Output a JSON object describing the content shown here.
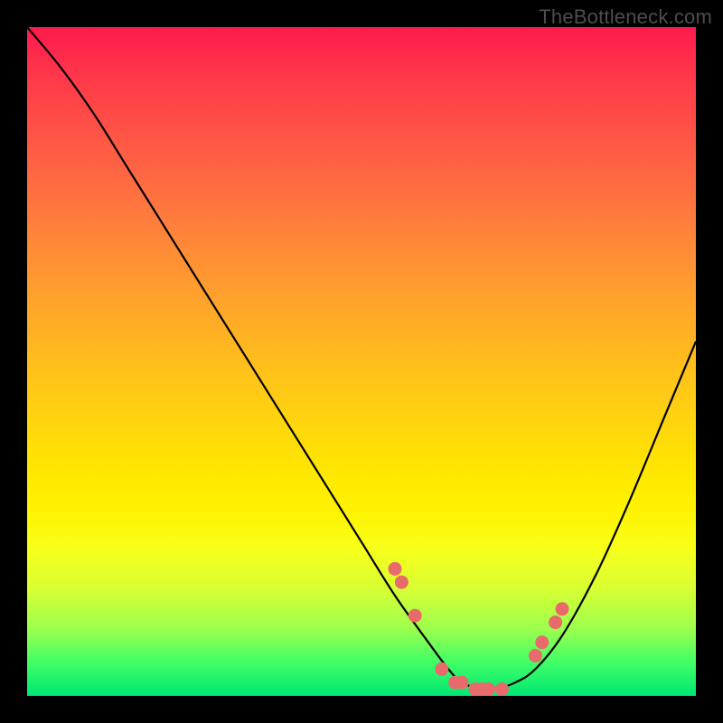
{
  "watermark": "TheBottleneck.com",
  "chart_data": {
    "type": "line",
    "title": "",
    "xlabel": "",
    "ylabel": "",
    "xlim": [
      0,
      100
    ],
    "ylim": [
      0,
      100
    ],
    "grid": false,
    "series": [
      {
        "name": "bottleneck-curve",
        "x": [
          0,
          5,
          10,
          15,
          20,
          25,
          30,
          35,
          40,
          45,
          50,
          55,
          60,
          63,
          65,
          68,
          70,
          73,
          76,
          80,
          85,
          90,
          95,
          100
        ],
        "values": [
          100,
          94,
          87,
          79,
          71,
          63,
          55,
          47,
          39,
          31,
          23,
          15,
          8,
          4,
          2,
          1,
          1,
          2,
          4,
          9,
          18,
          29,
          41,
          53
        ]
      }
    ],
    "markers": {
      "name": "highlighted-points",
      "color": "#e86a6a",
      "x": [
        55,
        56,
        58,
        62,
        64,
        65,
        67,
        68,
        69,
        71,
        76,
        77,
        79,
        80
      ],
      "values": [
        19,
        17,
        12,
        4,
        2,
        2,
        1,
        1,
        1,
        1,
        6,
        8,
        11,
        13
      ]
    },
    "gradient_stops": [
      {
        "pos": 0,
        "color": "#ff1a4d"
      },
      {
        "pos": 50,
        "color": "#ffd210"
      },
      {
        "pos": 75,
        "color": "#fff200"
      },
      {
        "pos": 100,
        "color": "#00e673"
      }
    ]
  }
}
